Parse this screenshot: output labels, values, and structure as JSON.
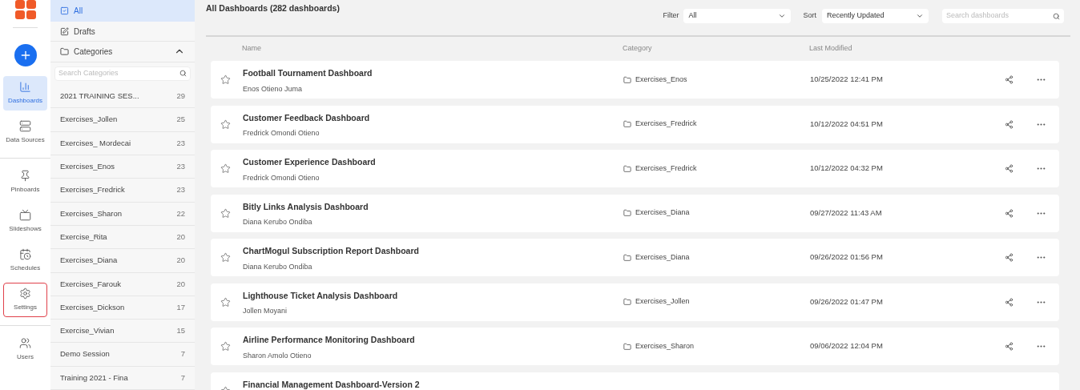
{
  "nav": [
    {
      "kind": "add"
    },
    {
      "kind": "dashboards",
      "label": "Dashboards",
      "selected": true,
      "outlined": false
    },
    {
      "kind": "datasources",
      "label": "Data Sources",
      "selected": false,
      "outlined": false
    },
    {
      "kind": "pinboards",
      "label": "Pinboards",
      "selected": false,
      "outlined": false
    },
    {
      "kind": "slideshows",
      "label": "Slideshows",
      "selected": false,
      "outlined": false
    },
    {
      "kind": "schedules",
      "label": "Schedules",
      "selected": false,
      "outlined": false
    },
    {
      "kind": "settings",
      "label": "Settings",
      "selected": false,
      "outlined": true
    },
    {
      "kind": "users",
      "label": "Users",
      "selected": false,
      "outlined": false
    }
  ],
  "panel": {
    "all": {
      "label": "All",
      "selected": true
    },
    "drafts": {
      "label": "Drafts",
      "selected": false
    },
    "categories": {
      "label": "Categories",
      "expanded": true
    },
    "search": {
      "placeholder": "Search Categories"
    },
    "items": [
      {
        "name": "2021 TRAINING SES...",
        "count": "29"
      },
      {
        "name": "Exercises_Jollen",
        "count": "25"
      },
      {
        "name": "Exercises_ Mordecai",
        "count": "23"
      },
      {
        "name": "Exercises_Enos",
        "count": "23"
      },
      {
        "name": "Exercises_Fredrick",
        "count": "23"
      },
      {
        "name": "Exercises_Sharon",
        "count": "22"
      },
      {
        "name": "Exercise_Rita",
        "count": "20"
      },
      {
        "name": "Exercises_Diana",
        "count": "20"
      },
      {
        "name": "Exercises_Farouk",
        "count": "20"
      },
      {
        "name": "Exercises_Dickson",
        "count": "17"
      },
      {
        "name": "Exercise_Vivian",
        "count": "15"
      },
      {
        "name": "Demo Session",
        "count": "7"
      },
      {
        "name": "Training 2021 - Fina",
        "count": "7"
      }
    ]
  },
  "header": {
    "title": "All Dashboards (282 dashboards)",
    "filter_label": "Filter",
    "filter_value": "All",
    "sort_label": "Sort",
    "sort_value": "Recently Updated",
    "search": {
      "placeholder": "Search dashboards"
    }
  },
  "table": {
    "columns": [
      "Name",
      "Category",
      "Last Modified"
    ],
    "rows": [
      {
        "title": "Football Tournament Dashboard",
        "author": "Enos Otieno Juma",
        "category": "Exercises_Enos",
        "modified": "10/25/2022 12:41 PM"
      },
      {
        "title": "Customer Feedback Dashboard",
        "author": "Fredrick Omondi Otieno",
        "category": "Exercises_Fredrick",
        "modified": "10/12/2022 04:51 PM"
      },
      {
        "title": "Customer Experience Dashboard",
        "author": "Fredrick Omondi Otieno",
        "category": "Exercises_Fredrick",
        "modified": "10/12/2022 04:32 PM"
      },
      {
        "title": "Bitly Links Analysis Dashboard",
        "author": "Diana Kerubo Ondiba",
        "category": "Exercises_Diana",
        "modified": "09/27/2022 11:43 AM"
      },
      {
        "title": "ChartMogul Subscription Report Dashboard",
        "author": "Diana Kerubo Ondiba",
        "category": "Exercises_Diana",
        "modified": "09/26/2022 01:56 PM"
      },
      {
        "title": "Lighthouse Ticket Analysis Dashboard",
        "author": "Jollen Moyani",
        "category": "Exercises_Jollen",
        "modified": "09/26/2022 01:47 PM"
      },
      {
        "title": "Airline Performance Monitoring Dashboard",
        "author": "Sharon Amolo Otieno",
        "category": "Exercises_Sharon",
        "modified": "09/06/2022 12:04 PM"
      },
      {
        "title": "Financial Management Dashboard-Version 2"
      }
    ]
  }
}
